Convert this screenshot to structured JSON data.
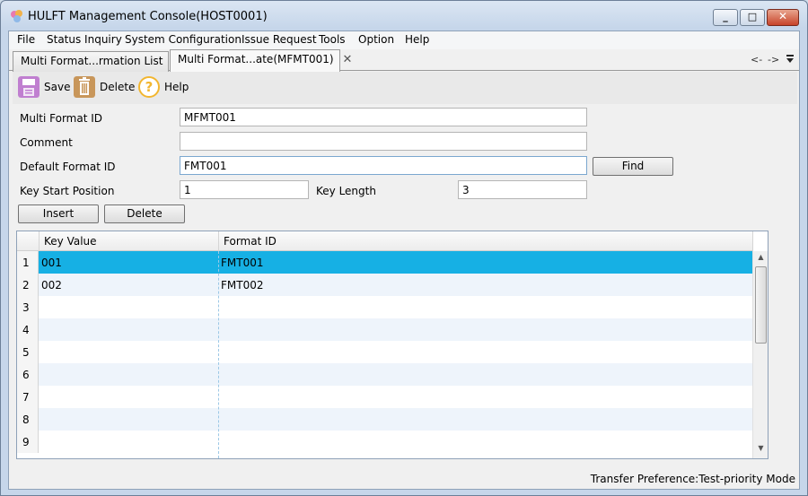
{
  "window": {
    "title": "HULFT Management Console(HOST0001)"
  },
  "menubar": {
    "items": [
      {
        "label": "File"
      },
      {
        "label": "Status Inquiry"
      },
      {
        "label": "System Configuration"
      },
      {
        "label": "Issue Request"
      },
      {
        "label": "Tools"
      },
      {
        "label": "Option"
      },
      {
        "label": "Help"
      }
    ]
  },
  "tabs": [
    {
      "label": "Multi Format...rmation List"
    },
    {
      "label": "Multi Format...ate(MFMT001)"
    }
  ],
  "tab_nav": {
    "back": "<-",
    "forward": "->"
  },
  "toolbar": {
    "save_label": "Save",
    "delete_label": "Delete",
    "help_label": "Help"
  },
  "form": {
    "multi_format_id_label": "Multi Format ID",
    "multi_format_id_value": "MFMT001",
    "comment_label": "Comment",
    "comment_value": "",
    "default_format_id_label": "Default Format ID",
    "default_format_id_value": "FMT001",
    "find_label": "Find",
    "key_start_position_label": "Key Start Position",
    "key_start_position_value": "1",
    "key_length_label": "Key Length",
    "key_length_value": "3",
    "insert_label": "Insert",
    "delete_label": "Delete"
  },
  "grid": {
    "columns": [
      "Key Value",
      "Format ID"
    ],
    "rows": [
      {
        "num": "1",
        "key_value": "001",
        "format_id": "FMT001"
      },
      {
        "num": "2",
        "key_value": "002",
        "format_id": "FMT002"
      },
      {
        "num": "3",
        "key_value": "",
        "format_id": ""
      },
      {
        "num": "4",
        "key_value": "",
        "format_id": ""
      },
      {
        "num": "5",
        "key_value": "",
        "format_id": ""
      },
      {
        "num": "6",
        "key_value": "",
        "format_id": ""
      },
      {
        "num": "7",
        "key_value": "",
        "format_id": ""
      },
      {
        "num": "8",
        "key_value": "",
        "format_id": ""
      },
      {
        "num": "9",
        "key_value": "",
        "format_id": ""
      }
    ],
    "selected_row": "1"
  },
  "status": {
    "text": "Transfer Preference:Test-priority Mode"
  },
  "colors": {
    "selection": "#16b0e4",
    "alt_row": "#eef4fb",
    "save_icon": "#c07fd0",
    "delete_icon": "#c8965a",
    "help_icon": "#f2b630"
  },
  "icons": {
    "app": "app-icon",
    "save": "floppy-disk-icon",
    "delete": "trash-can-icon",
    "help": "question-mark-icon",
    "tab_list": "chevron-down-icon",
    "tab_close": "close-icon"
  }
}
